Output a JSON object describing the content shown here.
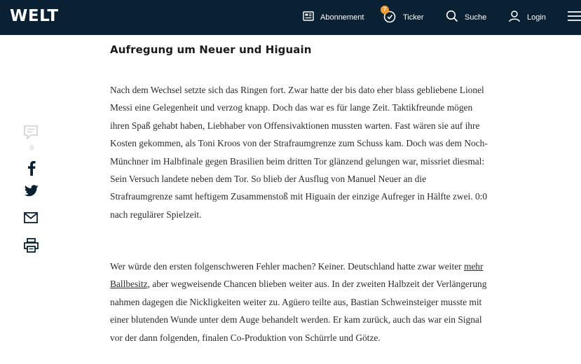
{
  "header": {
    "logo": "WELT",
    "nav": [
      {
        "label": "Abonnement",
        "icon": "newspaper-icon"
      },
      {
        "label": "Ticker",
        "icon": "clock-icon",
        "badge": "7"
      },
      {
        "label": "Suche",
        "icon": "search-icon"
      },
      {
        "label": "Login",
        "icon": "user-icon"
      }
    ],
    "menu_icon": "hamburger-menu-icon"
  },
  "article": {
    "headline": "Aufregung um Neuer und Higuain",
    "paragraph1": "Nach dem Wechsel setzte sich das Ringen fort. Zwar hatte der bis dato eher blass gebliebene Lionel Messi eine Gelegenheit und verzog knapp. Doch das war es für lange Zeit. Taktikfreunde mögen ihren Spaß gehabt haben, Liebhaber von Offensivaktionen mussten warten. Fast wären sie auf ihre Kosten gekommen, als Toni Kroos von der Strafraumgrenze zum Schuss kam. Doch was dem Noch-Münchner im Halbfinale gegen Brasilien beim dritten Tor glänzend gelungen war, missriet diesmal: Sein Versuch landete neben dem Tor. So blieb der Ausflug von Manuel Neuer an die Strafraumgrenze samt heftigem Zusammenstoß mit Higuain der einzige Aufreger in Hälfte zwei. 0:0 nach regulärer Spielzeit.",
    "paragraph2_before_link": "Wer würde den ersten folgenschweren Fehler machen? Keiner. Deutschland hatte zwar weiter ",
    "paragraph2_link": "mehr Ballbesitz",
    "paragraph2_after_link": ", aber wegweisende Chancen blieben weiter aus. In der zweiten Halbzeit der Verlängerung nahmen dagegen die Nickligkeiten weiter zu. Agüero teilte aus, Bastian Schweinsteiger musste mit einer blutenden Wunde unter dem Auge behandelt werden. Er kam zurück, auch das war ein Signal vor der dann folgenden, finalen Co-Produktion von Schürrle und Götze."
  },
  "social": {
    "comment_count": "0",
    "icons": [
      "comment-icon",
      "facebook-icon",
      "twitter-icon",
      "mail-icon",
      "print-icon"
    ]
  },
  "colors": {
    "header_bg": "#0a2134",
    "badge": "#f29a2e",
    "text": "#2b2b2b",
    "social_icon": "#0a2134",
    "comment_icon": "#cfcfcf"
  }
}
